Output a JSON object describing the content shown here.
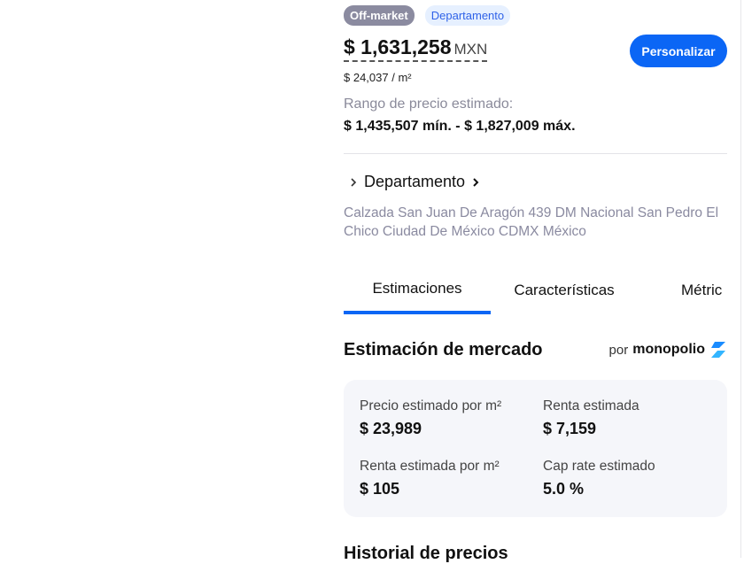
{
  "badges": {
    "status": "Off-market",
    "type": "Departamento"
  },
  "price": {
    "value": "$ 1,631,258",
    "currency": "MXN",
    "per_m2": "$ 24,037 / m²"
  },
  "customize_button": "Personalizar",
  "range": {
    "label": "Rango de precio estimado:",
    "value": "$ 1,435,507 mín. - $ 1,827,009 máx."
  },
  "property_type": "Departamento",
  "address": "Calzada San Juan De Aragón 439 DM Nacional San Pedro El Chico Ciudad De México CDMX México",
  "tabs": [
    {
      "label": "Estimaciones"
    },
    {
      "label": "Características"
    },
    {
      "label": "Métric"
    }
  ],
  "market": {
    "title": "Estimación de mercado",
    "by": "por",
    "brand": "monopolio",
    "metrics": [
      {
        "label": "Precio estimado por m²",
        "value": "$ 23,989"
      },
      {
        "label": "Renta estimada",
        "value": "$ 7,159"
      },
      {
        "label": "Renta estimada por m²",
        "value": "$ 105"
      },
      {
        "label": "Cap rate estimado",
        "value": "5.0 %"
      }
    ]
  },
  "history_title": "Historial de precios"
}
